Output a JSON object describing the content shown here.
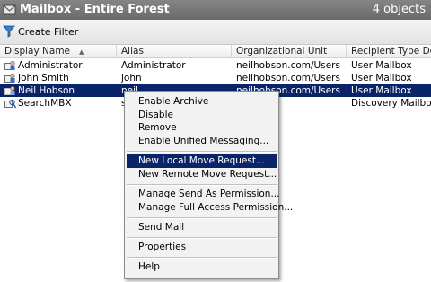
{
  "window": {
    "title": "Mailbox - Entire Forest",
    "count": "4 objects"
  },
  "toolbar": {
    "create_filter": "Create Filter"
  },
  "columns": [
    "Display Name",
    "Alias",
    "Organizational Unit",
    "Recipient Type Detail"
  ],
  "rows": [
    {
      "name": "Administrator",
      "alias": "Administrator",
      "ou": "neilhobson.com/Users",
      "type": "User Mailbox"
    },
    {
      "name": "John Smith",
      "alias": "john",
      "ou": "neilhobson.com/Users",
      "type": "User Mailbox"
    },
    {
      "name": "Neil Hobson",
      "alias": "neil",
      "ou": "neilhobson.com/Users",
      "type": "User Mailbox"
    },
    {
      "name": "SearchMBX",
      "alias": "s",
      "ou": "",
      "type": "Discovery Mailbox"
    }
  ],
  "menu": [
    "Enable Archive",
    "Disable",
    "Remove",
    "Enable Unified Messaging...",
    "New Local Move Request...",
    "New Remote Move Request...",
    "Manage Send As Permission...",
    "Manage Full Access Permission...",
    "Send Mail",
    "Properties",
    "Help"
  ],
  "colors": {
    "selection": "#0a246a",
    "titlebar": "#7a7a7a"
  }
}
